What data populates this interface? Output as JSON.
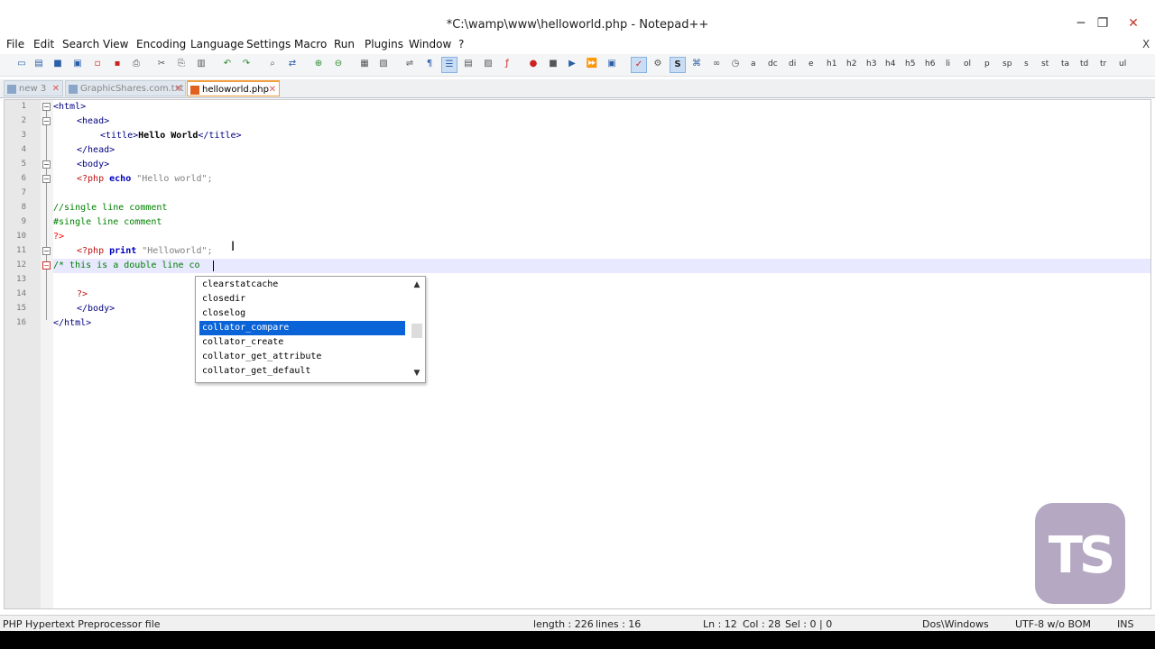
{
  "window": {
    "title": "*C:\\wamp\\www\\helloworld.php - Notepad++",
    "min": "─",
    "max": "❐",
    "close": "✕"
  },
  "menu": [
    "File",
    "Edit",
    "Search",
    "View",
    "Encoding",
    "Language",
    "Settings",
    "Macro",
    "Run",
    "Plugins",
    "Window",
    "?"
  ],
  "menu_close": "X",
  "toolbar_tags": [
    "a",
    "dc",
    "di",
    "e",
    "h1",
    "h2",
    "h3",
    "h4",
    "h5",
    "h6",
    "li",
    "ol",
    "p",
    "sp",
    "s",
    "st",
    "ta",
    "td",
    "tr",
    "ul"
  ],
  "tabs": [
    {
      "label": "new  3"
    },
    {
      "label": "GraphicShares.com.txt"
    },
    {
      "label": "helloworld.php"
    }
  ],
  "editor": {
    "line_numbers": [
      "1",
      "2",
      "3",
      "4",
      "5",
      "6",
      "7",
      "8",
      "9",
      "10",
      "11",
      "12",
      "13",
      "14",
      "15",
      "16"
    ],
    "lines": {
      "l1": "<html>",
      "l2": "<head>",
      "l3a": "<title>",
      "l3b": "Hello World",
      "l3c": "</title>",
      "l4": "</head>",
      "l5": "<body>",
      "l6a": "<?php",
      "l6b": " echo",
      "l6c": " \"Hello world\";",
      "l8": "//single line comment",
      "l9": "#single line comment",
      "l10": "?>",
      "l11a": "<?php",
      "l11b": " print",
      "l11c": " \"Helloworld\";",
      "l12": "/* this is a double line co",
      "l14": "?>",
      "l15": "</body>",
      "l16": "</html>"
    }
  },
  "autocomplete": {
    "items": [
      "clearstatcache",
      "closedir",
      "closelog",
      "collator_compare",
      "collator_create",
      "collator_get_attribute",
      "collator_get_default"
    ],
    "selected_index": 3
  },
  "logo": {
    "text": "TS"
  },
  "status": {
    "file_type": "PHP Hypertext Preprocessor file",
    "length": "length : 226",
    "lines": "lines : 16",
    "ln": "Ln : 12",
    "col": "Col : 28",
    "sel": "Sel : 0 | 0",
    "eol": "Dos\\Windows",
    "encoding": "UTF-8 w/o BOM",
    "mode": "INS"
  }
}
